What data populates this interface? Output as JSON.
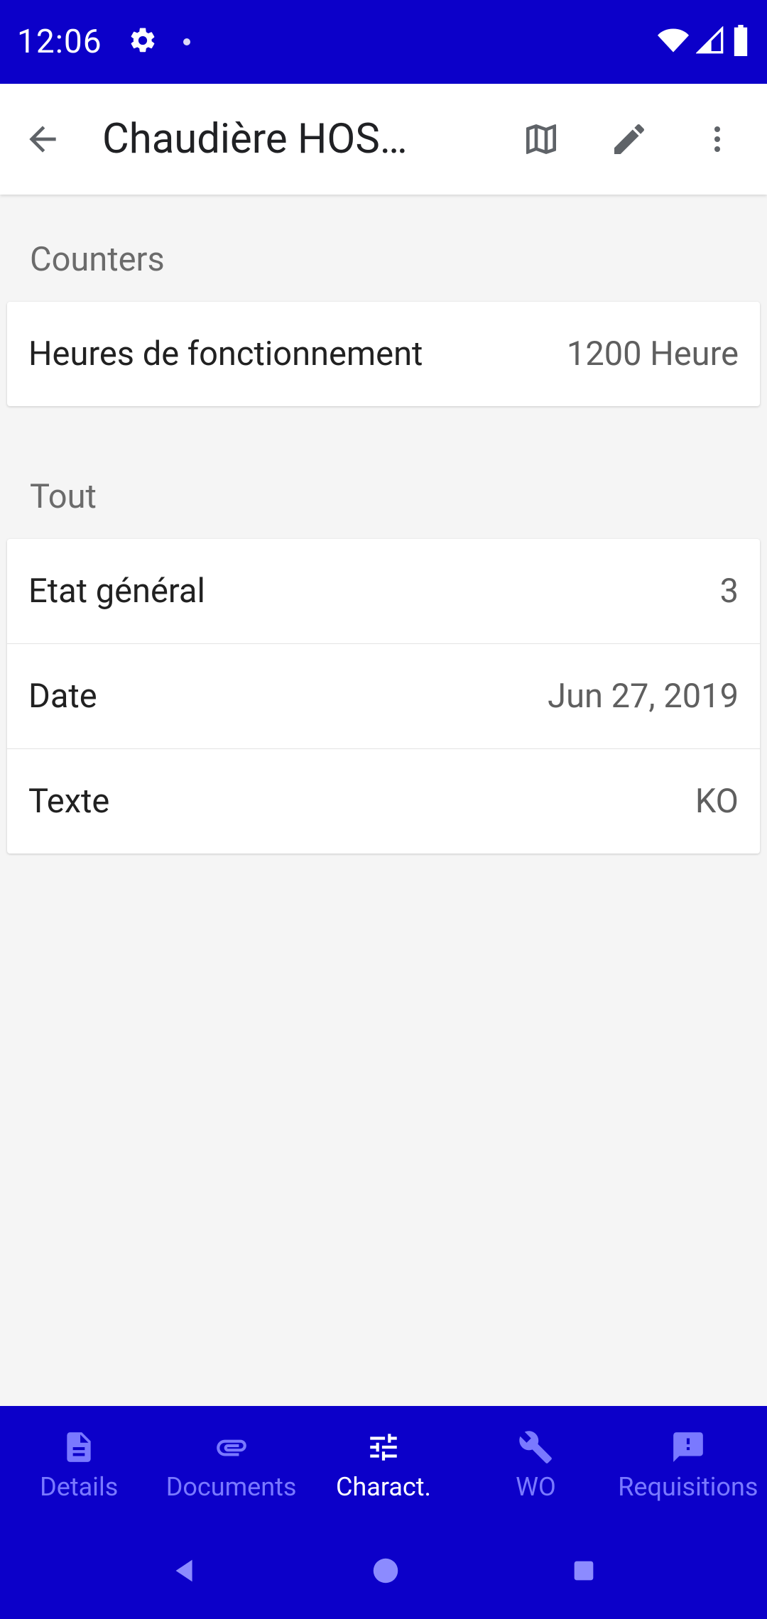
{
  "status": {
    "time": "12:06"
  },
  "header": {
    "title": "Chaudière HOS…"
  },
  "sections": [
    {
      "title": "Counters",
      "rows": [
        {
          "label": "Heures de fonctionnement",
          "value": "1200 Heure"
        }
      ]
    },
    {
      "title": "Tout",
      "rows": [
        {
          "label": "Etat général",
          "value": "3"
        },
        {
          "label": "Date",
          "value": "Jun 27, 2019"
        },
        {
          "label": "Texte",
          "value": "KO"
        }
      ]
    }
  ],
  "bottomNav": {
    "items": [
      {
        "label": "Details"
      },
      {
        "label": "Documents"
      },
      {
        "label": "Charact."
      },
      {
        "label": "WO"
      },
      {
        "label": "Requisitions"
      }
    ],
    "activeIndex": 2
  },
  "colors": {
    "primary": "#0c00c9"
  }
}
